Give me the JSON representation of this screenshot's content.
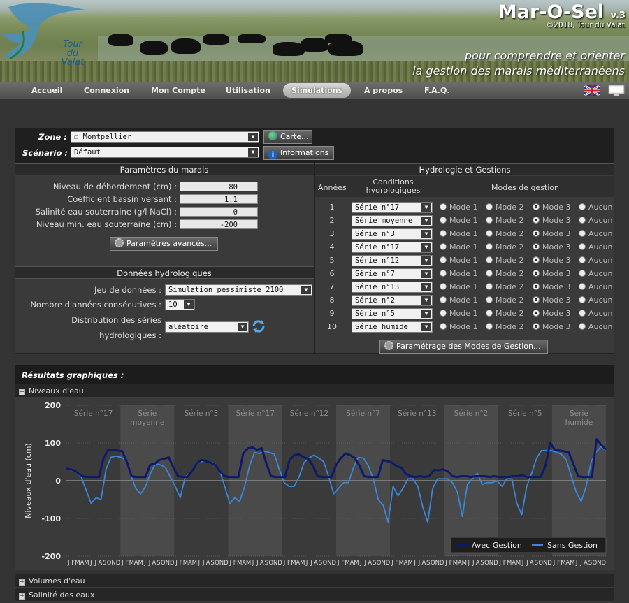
{
  "header": {
    "app_title": "Mar-O-Sel",
    "version": "v.3",
    "copyright": "©2018, Tour du Valat",
    "logo_lines": [
      "Tour",
      "du",
      "Valat"
    ],
    "tagline_1": "pour comprendre et orienter",
    "tagline_2": "la gestion des marais méditerranéens"
  },
  "nav": {
    "items": [
      "Accueil",
      "Connexion",
      "Mon Compte",
      "Utilisation",
      "Simulations",
      "A propos",
      "F.A.Q."
    ],
    "active": "Simulations"
  },
  "form": {
    "zone_label": "Zone :",
    "zone_value": "☐ Montpellier",
    "map_button": "Carte...",
    "scenario_label": "Scénario :",
    "scenario_value": "Défaut",
    "info_button": "Informations"
  },
  "marsh": {
    "title": "Paramètres du marais",
    "params": [
      {
        "label": "Niveau de débordement (cm) :",
        "value": "80"
      },
      {
        "label": "Coefficient bassin versant :",
        "value": "1.1"
      },
      {
        "label": "Salinité eau souterraine (g/l NaCl) :",
        "value": "0"
      },
      {
        "label": "Niveau min. eau souterraine (cm) :",
        "value": "-200"
      }
    ],
    "advanced_button": "Paramètres avancés..."
  },
  "hydro_data": {
    "title": "Données hydrologiques",
    "dataset_label": "Jeu de données :",
    "dataset_value": "Simulation pessimiste 2100",
    "years_label": "Nombre d'années consécutives :",
    "years_value": "10",
    "dist_label_1": "Distribution des séries",
    "dist_label_2": "hydrologiques :",
    "dist_value": "aléatoire"
  },
  "hydrology": {
    "title": "Hydrologie et Gestions",
    "col_years": "Années",
    "col_conditions_1": "Conditions",
    "col_conditions_2": "hydrologiques",
    "col_modes": "Modes de gestion",
    "mode_labels": [
      "Mode 1",
      "Mode 2",
      "Mode 3",
      "Aucun"
    ],
    "rows": [
      {
        "year": "1",
        "series": "Série n°17",
        "mode": 2
      },
      {
        "year": "2",
        "series": "Série moyenne",
        "mode": 2
      },
      {
        "year": "3",
        "series": "Série n°3",
        "mode": 2
      },
      {
        "year": "4",
        "series": "Série n°17",
        "mode": 2
      },
      {
        "year": "5",
        "series": "Série n°12",
        "mode": 2
      },
      {
        "year": "6",
        "series": "Série n°7",
        "mode": 2
      },
      {
        "year": "7",
        "series": "Série n°13",
        "mode": 2
      },
      {
        "year": "8",
        "series": "Série n°2",
        "mode": 2
      },
      {
        "year": "9",
        "series": "Série n°5",
        "mode": 2
      },
      {
        "year": "10",
        "series": "Série humide",
        "mode": 2
      }
    ],
    "modes_button": "Paramétrage des Modes de Gestion..."
  },
  "results": {
    "title": "Résultats graphiques :",
    "sections": [
      "Niveaux d'eau",
      "Volumes d'eau",
      "Salinité des eaux"
    ]
  },
  "chart_data": {
    "type": "line",
    "ylabel": "Niveaux d'eau (cm)",
    "ylim": [
      -200,
      200
    ],
    "yticks": [
      200,
      100,
      0,
      -100,
      -200
    ],
    "grid": true,
    "legend_position": "bottom-right",
    "year_bands": [
      [
        "Série n°17"
      ],
      [
        "Série",
        "moyenne"
      ],
      [
        "Série n°3"
      ],
      [
        "Série n°17"
      ],
      [
        "Série n°12"
      ],
      [
        "Série n°7"
      ],
      [
        "Série n°13"
      ],
      [
        "Série n°2"
      ],
      [
        "Série n°5"
      ],
      [
        "Série",
        "humide"
      ]
    ],
    "month_letters": [
      "J",
      "F",
      "M",
      "A",
      "M",
      "J",
      "J",
      "A",
      "S",
      "O",
      "N",
      "D"
    ],
    "series": [
      {
        "name": "Avec Gestion",
        "color": "#0d1a6b",
        "values": [
          32,
          30,
          25,
          15,
          10,
          10,
          10,
          10,
          60,
          82,
          82,
          80,
          78,
          50,
          12,
          10,
          10,
          10,
          42,
          45,
          55,
          58,
          62,
          35,
          12,
          10,
          10,
          25,
          45,
          55,
          52,
          48,
          42,
          25,
          12,
          10,
          10,
          10,
          72,
          86,
          88,
          82,
          86,
          45,
          12,
          10,
          10,
          10,
          55,
          68,
          70,
          62,
          58,
          40,
          12,
          10,
          10,
          10,
          42,
          60,
          72,
          68,
          60,
          40,
          12,
          10,
          10,
          10,
          55,
          52,
          48,
          38,
          35,
          18,
          12,
          10,
          12,
          10,
          12,
          28,
          28,
          30,
          25,
          12,
          10,
          12,
          12,
          10,
          12,
          12,
          12,
          10,
          12,
          10,
          10,
          10,
          12,
          12,
          15,
          10,
          10,
          10,
          10,
          40,
          100,
          82,
          80,
          78,
          75,
          45,
          12,
          10,
          10,
          10,
          110,
          95,
          82
        ]
      },
      {
        "name": "Sans Gestion",
        "color": "#3a86d8",
        "values": [
          32,
          28,
          22,
          10,
          -25,
          -60,
          -45,
          -50,
          30,
          62,
          65,
          62,
          55,
          15,
          -20,
          -35,
          -15,
          20,
          45,
          42,
          35,
          10,
          -15,
          -45,
          10,
          20,
          40,
          50,
          52,
          50,
          45,
          25,
          -15,
          -60,
          -45,
          -55,
          -15,
          40,
          75,
          72,
          78,
          75,
          70,
          30,
          -5,
          -15,
          -15,
          10,
          48,
          60,
          68,
          60,
          50,
          10,
          -35,
          -20,
          -5,
          -5,
          35,
          62,
          60,
          40,
          5,
          -50,
          -65,
          -110,
          -15,
          -40,
          -20,
          5,
          5,
          -15,
          -70,
          -110,
          -20,
          5,
          5,
          5,
          -5,
          -30,
          -95,
          -10,
          5,
          20,
          -10,
          -5,
          -5,
          0,
          -15,
          5,
          5,
          -60,
          -90,
          -15,
          20,
          60,
          80,
          80,
          80,
          75,
          70,
          55,
          12,
          -30,
          -55,
          -15,
          50,
          75,
          90,
          80
        ]
      }
    ]
  }
}
